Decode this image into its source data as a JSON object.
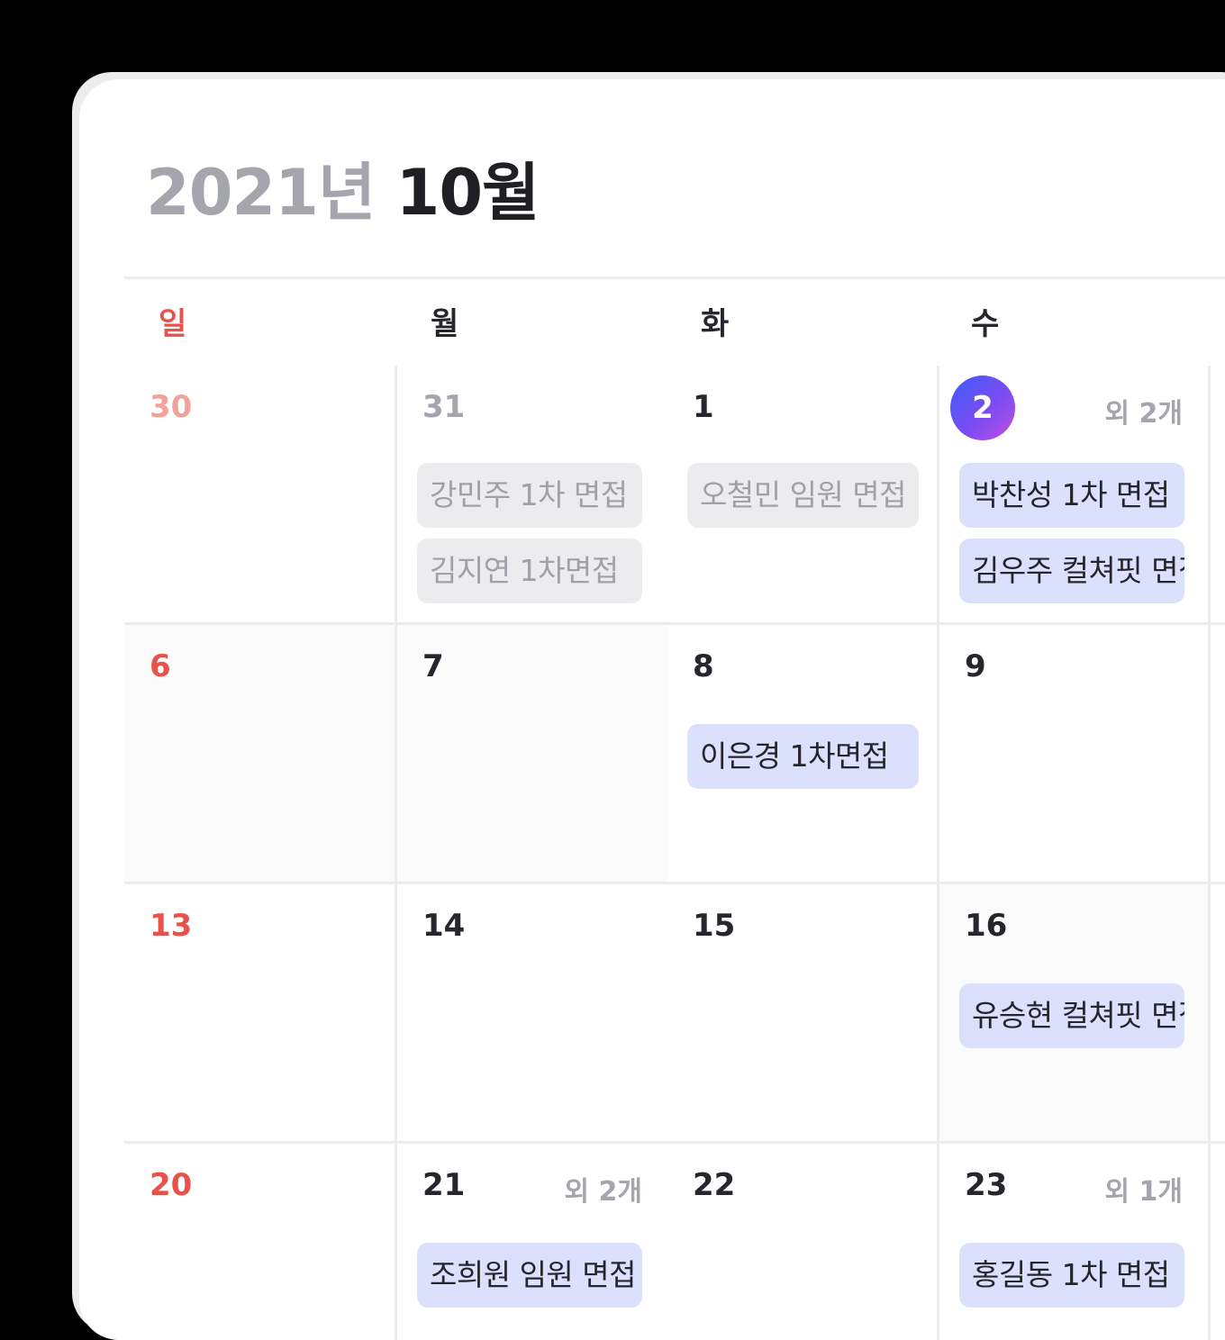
{
  "header": {
    "year": "2021년",
    "month": "10월"
  },
  "weekdays": [
    "일",
    "월",
    "화",
    "수"
  ],
  "weeks": [
    {
      "sun": {
        "day": "30"
      },
      "mon": {
        "day": "31",
        "events": [
          "강민주 1차 면접",
          "김지연 1차면접"
        ]
      },
      "tue": {
        "day": "1",
        "events": [
          "오철민 임원 면접"
        ]
      },
      "wed": {
        "day": "2",
        "more": "외 2개",
        "events": [
          "박찬성 1차 면접",
          "김우주 컬쳐핏 면접"
        ]
      }
    },
    {
      "sun": {
        "day": "6"
      },
      "mon": {
        "day": "7"
      },
      "tue": {
        "day": "8",
        "events": [
          "이은경 1차면접"
        ]
      },
      "wed": {
        "day": "9"
      }
    },
    {
      "sun": {
        "day": "13"
      },
      "mon": {
        "day": "14"
      },
      "tue": {
        "day": "15"
      },
      "wed": {
        "day": "16",
        "events": [
          "유승현 컬쳐핏 면접"
        ]
      }
    },
    {
      "sun": {
        "day": "20"
      },
      "mon": {
        "day": "21",
        "more": "외 2개",
        "events": [
          "조희원 임원 면접"
        ]
      },
      "tue": {
        "day": "22"
      },
      "wed": {
        "day": "23",
        "more": "외 1개",
        "events": [
          "홍길동 1차 면접"
        ]
      }
    }
  ],
  "colors": {
    "sunday": "#e8524a",
    "today_gradient": [
      "#3d5dff",
      "#c04ee8"
    ],
    "event_upcoming": "#dbe0fd",
    "event_past": "#ececef"
  }
}
